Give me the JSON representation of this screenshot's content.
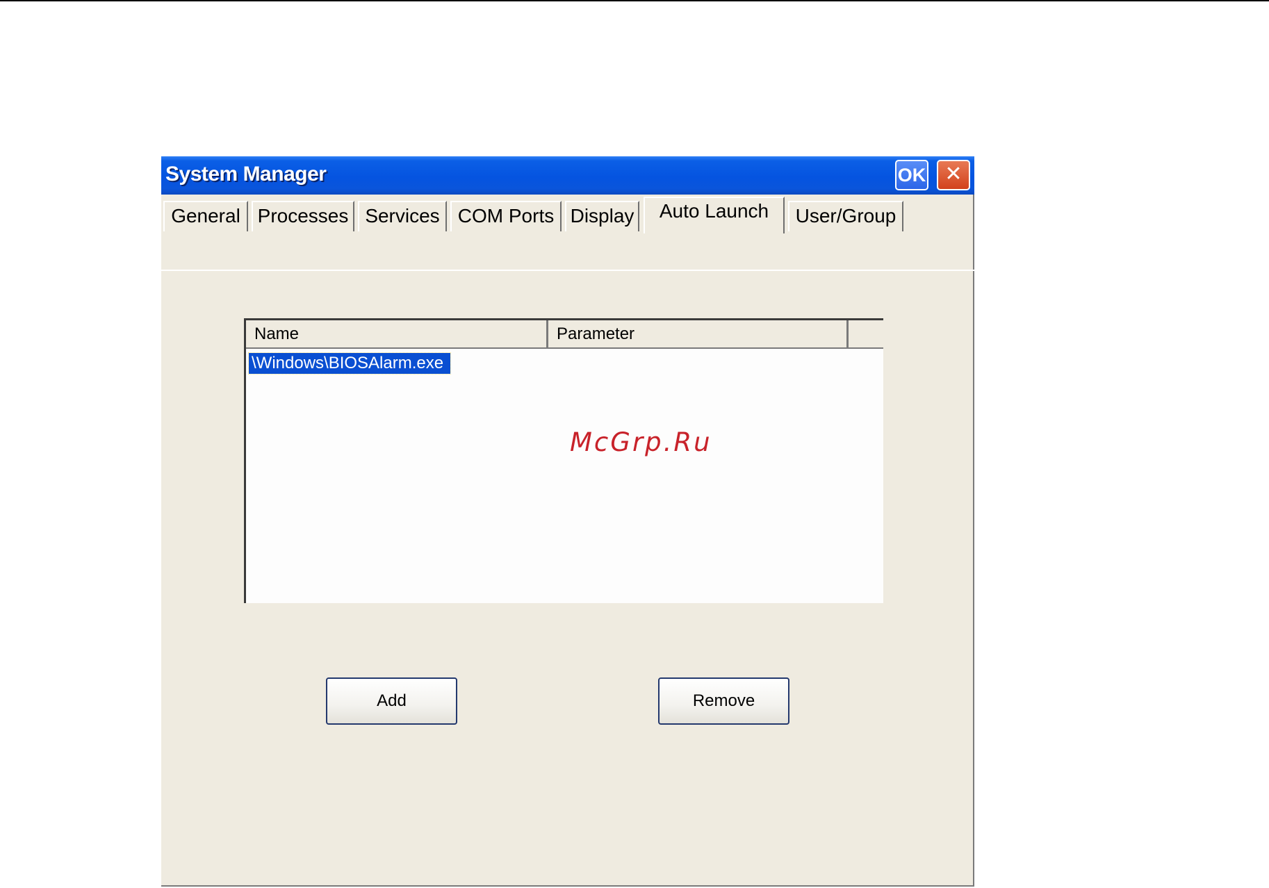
{
  "window": {
    "title": "System Manager",
    "ok_label": "OK",
    "close_symbol": "✕"
  },
  "tabs": [
    {
      "label": "General",
      "active": false
    },
    {
      "label": "Processes",
      "active": false
    },
    {
      "label": "Services",
      "active": false
    },
    {
      "label": "COM Ports",
      "active": false
    },
    {
      "label": "Display",
      "active": false
    },
    {
      "label": "Auto Launch",
      "active": true
    },
    {
      "label": "User/Group",
      "active": false
    }
  ],
  "list": {
    "columns": [
      "Name",
      "Parameter",
      ""
    ],
    "rows": [
      {
        "name": "\\Windows\\BIOSAlarm.exe",
        "parameter": "",
        "selected": true
      }
    ]
  },
  "buttons": {
    "add": "Add",
    "remove": "Remove"
  },
  "watermark": "McGrp.Ru",
  "colors": {
    "titlebar": "#0554e0",
    "window_bg": "#efebe0",
    "selection": "#0a4fd2",
    "watermark": "#c8222a"
  }
}
